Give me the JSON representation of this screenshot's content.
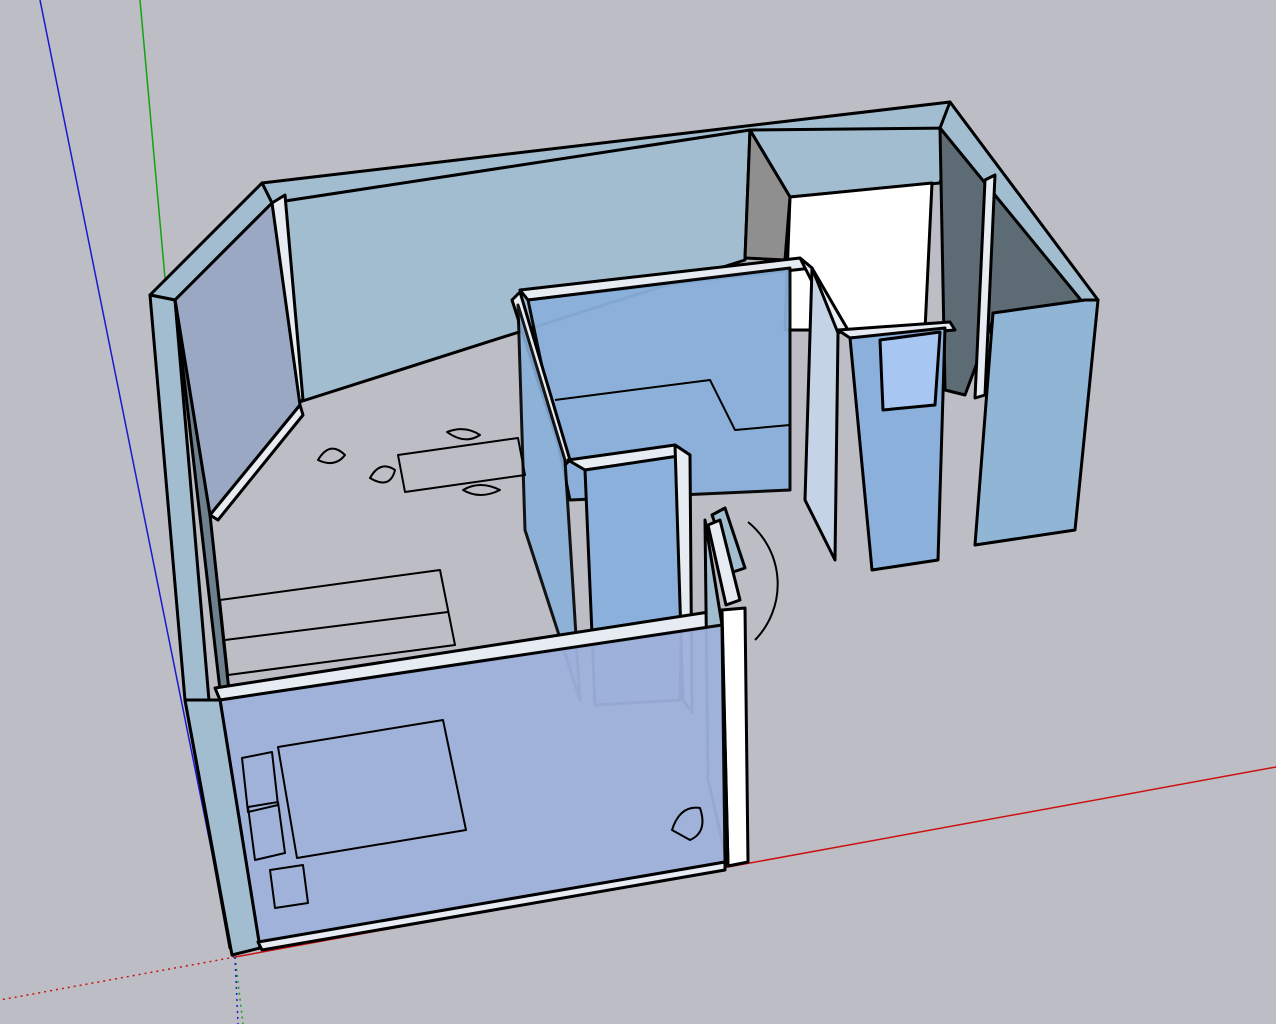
{
  "viewport": {
    "background": "#bdbdc5",
    "wall_color": "#a2bdd0",
    "dark_wall_color": "#5d6b75",
    "glass_color": "#90b0dd",
    "floor_color": "#bdbdc5",
    "edge_color": "#000000",
    "axis_colors": {
      "red": "#cc0000",
      "green": "#00aa00",
      "blue": "#0000cc"
    }
  },
  "model": {
    "name": "room-layout-3d"
  }
}
